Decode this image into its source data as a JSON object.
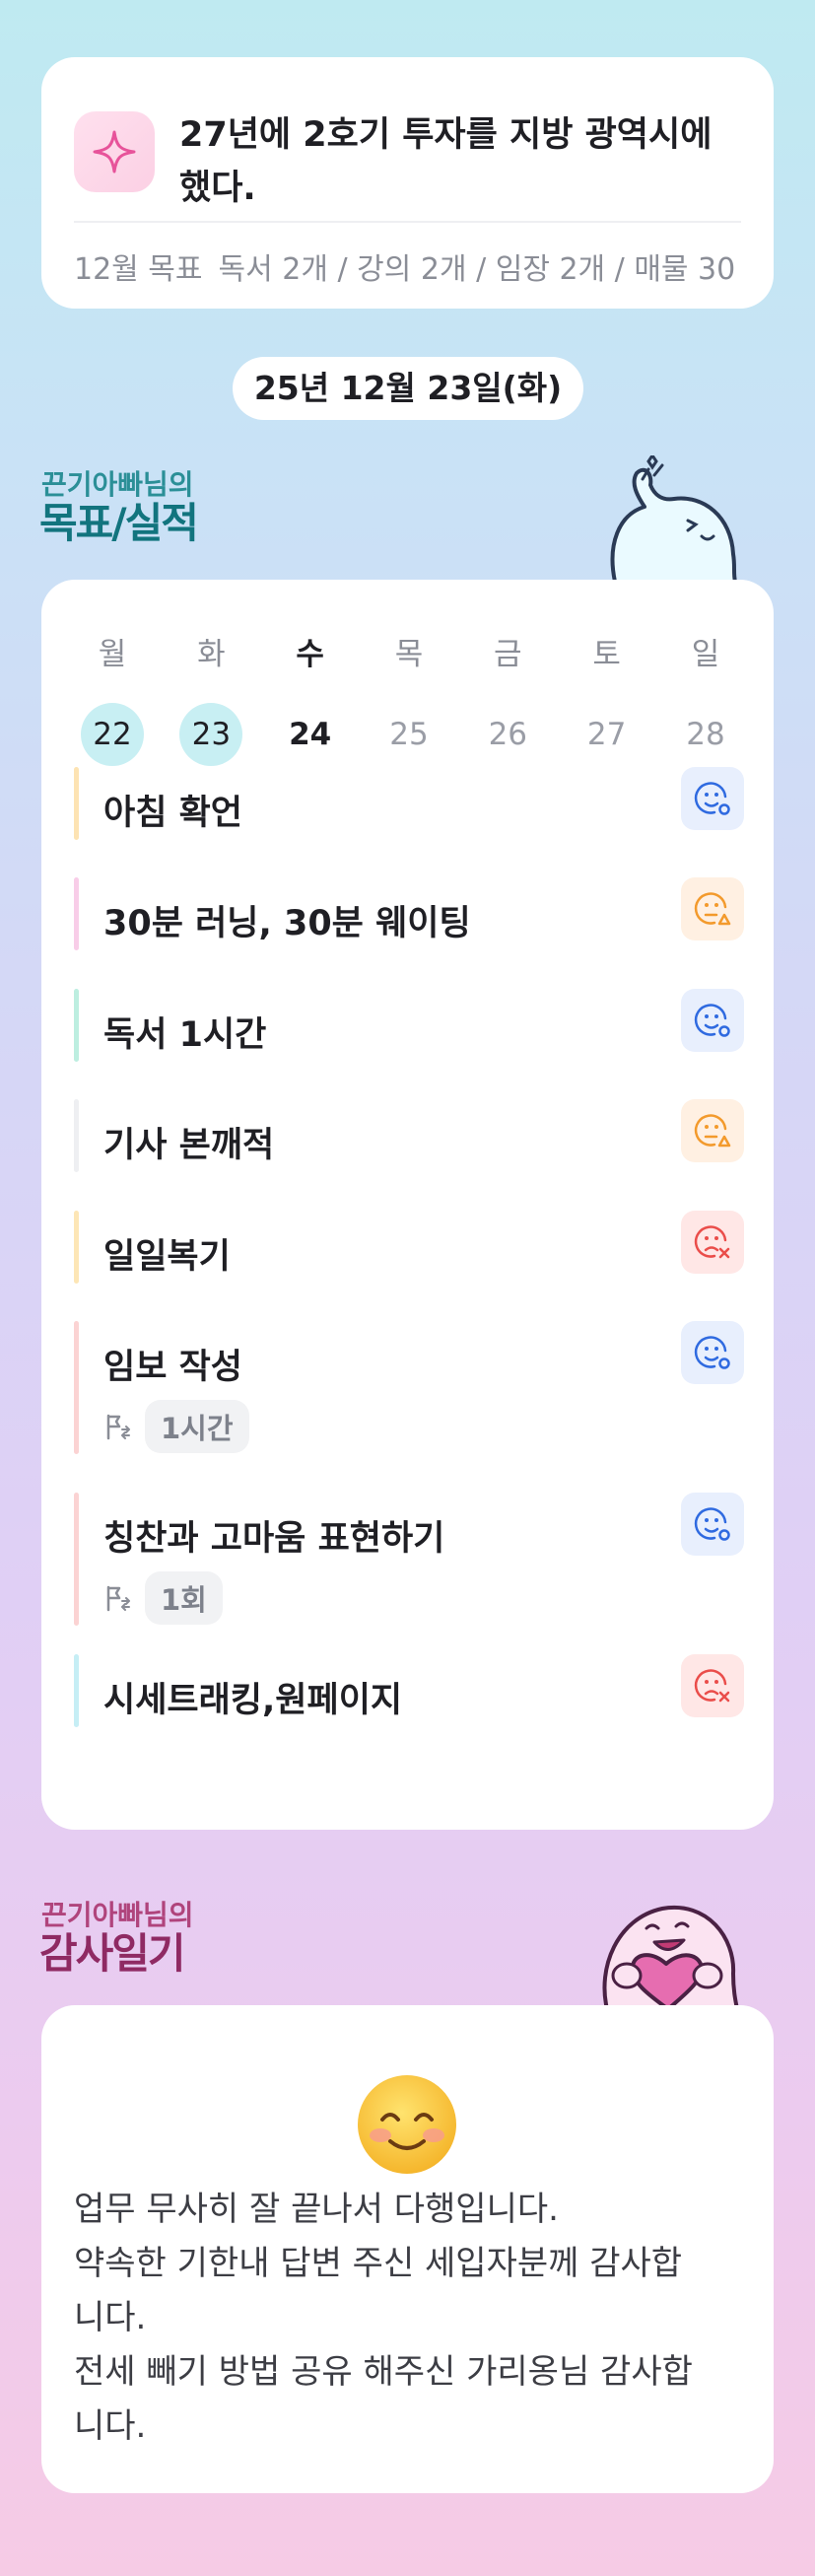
{
  "goal": {
    "text": "27년에 2호기 투자를 지방 광역시에 했다.",
    "sub_label": "12월 목표",
    "sub_text": "독서 2개 / 강의 2개 / 임장 2개 / 매물 30"
  },
  "date": "25년 12월 23일(화)",
  "goals_section": {
    "small": "끈기아빠님의",
    "big": "목표/실적"
  },
  "week": {
    "days": [
      "월",
      "화",
      "수",
      "목",
      "금",
      "토",
      "일"
    ],
    "dates": [
      "22",
      "23",
      "24",
      "25",
      "26",
      "27",
      "28"
    ],
    "done_indices": [
      0,
      1
    ],
    "today_index": 2
  },
  "tasks": [
    {
      "name": "아침 확언",
      "status": "good",
      "bar_color": "#fde3b3"
    },
    {
      "name": "30분 러닝, 30분 웨이팅",
      "status": "mid",
      "bar_color": "#f8cde8"
    },
    {
      "name": "독서 1시간",
      "status": "good",
      "bar_color": "#bdeee0"
    },
    {
      "name": "기사 본깨적",
      "status": "mid",
      "bar_color": "#eeeff2"
    },
    {
      "name": "일일복기",
      "status": "bad",
      "bar_color": "#fde6b6"
    },
    {
      "name": "임보 작성",
      "status": "good",
      "bar_color": "#fbd3d3",
      "meta": "1시간"
    },
    {
      "name": "칭찬과 고마움 표현하기",
      "status": "good",
      "bar_color": "#fbd3d3",
      "meta": "1회"
    },
    {
      "name": "시세트래킹,원페이지",
      "status": "bad",
      "bar_color": "#c6eef5"
    }
  ],
  "status_colors": {
    "good": "#2f6ae0",
    "mid": "#f39a2c",
    "bad": "#ea4d4a"
  },
  "thanks_section": {
    "small": "끈기아빠님의",
    "big": "감사일기"
  },
  "diary": {
    "emoji": "smiling-face-with-smiling-eyes",
    "lines": [
      "업무 무사히 잘 끝나서 다행입니다.",
      "약속한 기한내 답변 주신 세입자분께 감사합",
      "니다.",
      "전세 빼기 방법 공유 해주신 가리옹님 감사합",
      "니다."
    ]
  }
}
